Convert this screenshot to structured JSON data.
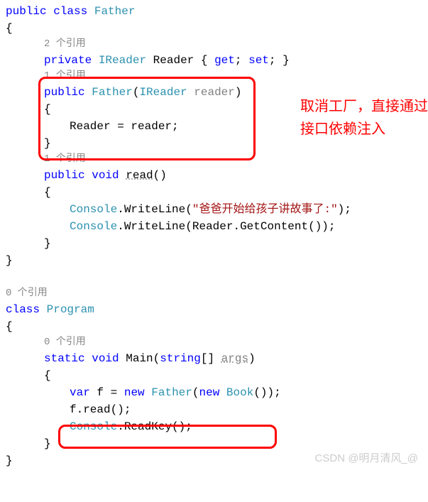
{
  "code": {
    "l1_public": "public",
    "l1_class": "class",
    "l1_father": "Father",
    "l2_brace": "{",
    "l3_ref": "2 个引用",
    "l4_private": "private",
    "l4_ireader": "IReader",
    "l4_reader": "Reader",
    "l4_get": "get",
    "l4_set": "set",
    "l5_ref": "1 个引用",
    "l6_public": "public",
    "l6_father": "Father",
    "l6_ireader": "IReader",
    "l6_reader": "reader",
    "l7_brace": "{",
    "l8_assign": "Reader = reader;",
    "l9_brace": "}",
    "l10_ref": "1 个引用",
    "l11_public": "public",
    "l11_void": "void",
    "l11_read": "read",
    "l12_brace": "{",
    "l13_console": "Console",
    "l13_wl": "WriteLine",
    "l13_str": "\"爸爸开始给孩子讲故事了:\"",
    "l14_console": "Console",
    "l14_wl": "WriteLine",
    "l14_reader": "Reader",
    "l14_getc": "GetContent",
    "l15_brace": "}",
    "l16_brace": "}",
    "p0_ref": "0 个引用",
    "p1_class": "class",
    "p1_program": "Program",
    "p2_brace": "{",
    "p3_ref": "0 个引用",
    "p4_static": "static",
    "p4_void": "void",
    "p4_main": "Main",
    "p4_string": "string",
    "p4_args": "args",
    "p5_brace": "{",
    "p6_var": "var",
    "p6_f": "f",
    "p6_new1": "new",
    "p6_father": "Father",
    "p6_new2": "new",
    "p6_book": "Book",
    "p7_fread": "f.read();",
    "p8_console": "Console",
    "p8_readkey": "ReadKey",
    "p9_brace": "}",
    "p10_brace": "}"
  },
  "annotation": "取消工厂，直接通过接口依赖注入",
  "watermark": "CSDN @明月清风_@"
}
